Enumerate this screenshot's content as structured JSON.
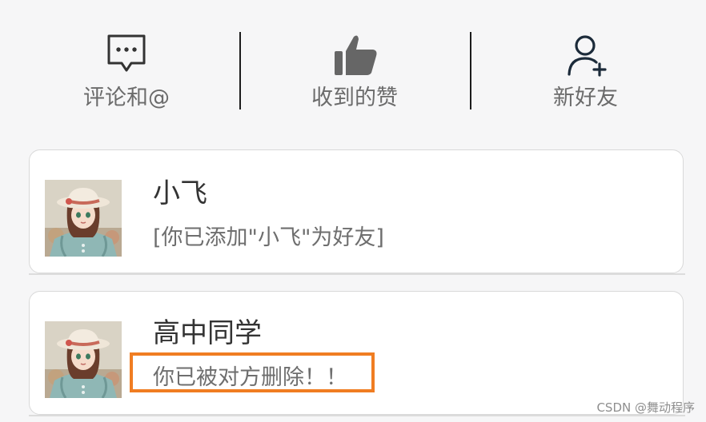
{
  "tabs": [
    {
      "label": "评论和@",
      "icon": "comment-icon"
    },
    {
      "label": "收到的赞",
      "icon": "thumbs-up-icon"
    },
    {
      "label": "新好友",
      "icon": "add-user-icon"
    }
  ],
  "conversations": [
    {
      "name": "小飞",
      "message": "[你已添加\"小飞\"为好友]"
    },
    {
      "name": "高中同学",
      "message": "你已被对方删除！！"
    }
  ],
  "watermark": "CSDN @舞动程序",
  "colors": {
    "highlight": "#f07d22",
    "background": "#f6f6f7"
  }
}
